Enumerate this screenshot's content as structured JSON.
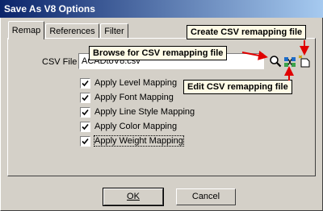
{
  "window": {
    "title": "Save As V8 Options"
  },
  "tabs": [
    {
      "label": "Remap",
      "active": true
    },
    {
      "label": "References",
      "active": false
    },
    {
      "label": "Filter",
      "active": false
    }
  ],
  "csv": {
    "label": "CSV File",
    "value": "ACADtoV8.csv"
  },
  "icons": {
    "browse": "magnifier-icon",
    "edit": "edit-remap-icon",
    "create": "new-file-icon"
  },
  "checkboxes": [
    {
      "label": "Apply Level Mapping",
      "checked": true
    },
    {
      "label": "Apply Font Mapping",
      "checked": true
    },
    {
      "label": "Apply Line Style Mapping",
      "checked": true
    },
    {
      "label": "Apply Color Mapping",
      "checked": true
    },
    {
      "label": "Apply Weight Mapping",
      "checked": true
    }
  ],
  "callouts": {
    "create": "Create CSV remapping file",
    "browse": "Browse for CSV remapping file",
    "edit": "Edit CSV remapping file"
  },
  "buttons": {
    "ok": "OK",
    "cancel": "Cancel"
  },
  "colors": {
    "titlebar_start": "#0a246a",
    "titlebar_end": "#a6caf0",
    "arrow": "#e00000",
    "dialog_bg": "#d4d0c8"
  }
}
